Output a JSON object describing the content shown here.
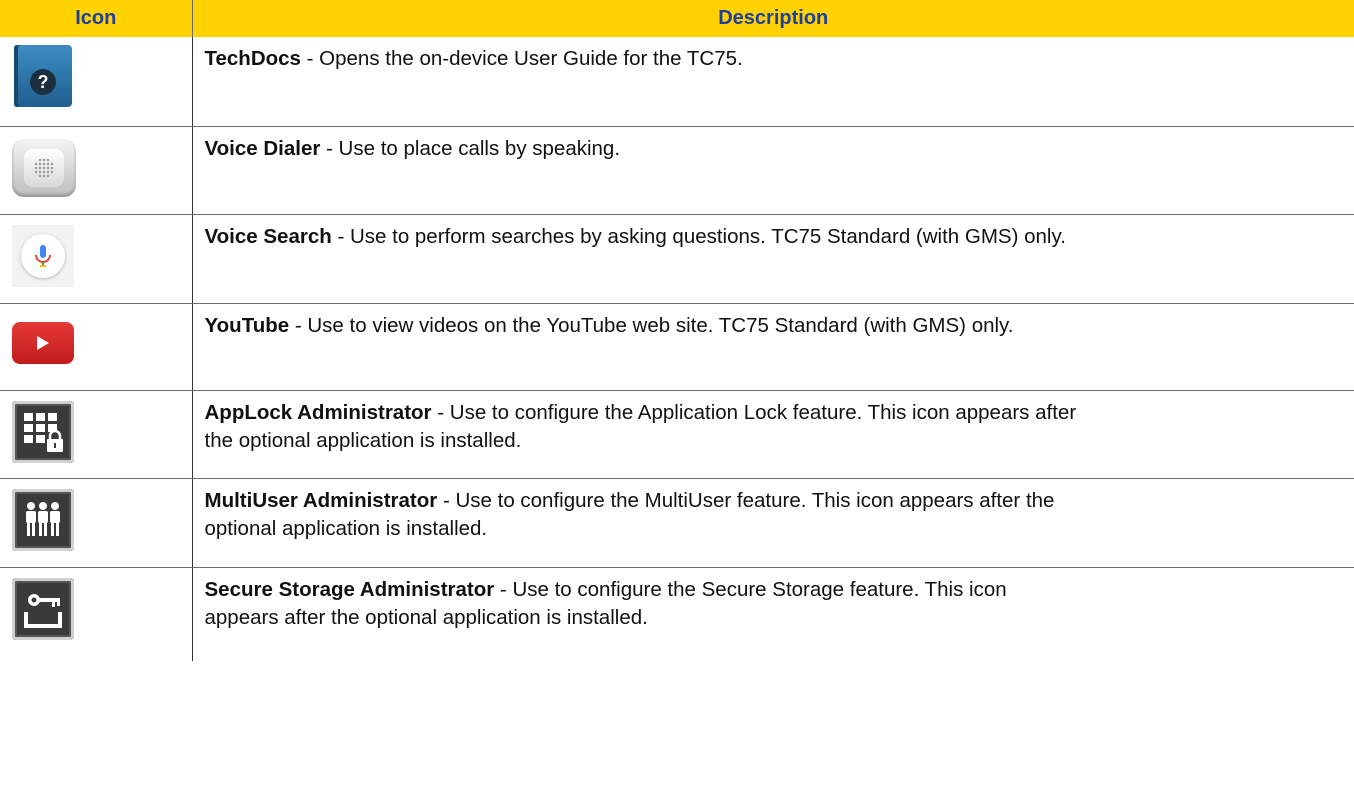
{
  "header": {
    "icon_col": "Icon",
    "description_col": "Description"
  },
  "rows": [
    {
      "icon": "techdocs-icon",
      "name": "TechDocs",
      "text": " - Opens the on-device User Guide for the TC75.",
      "line2": ""
    },
    {
      "icon": "voice-dialer-icon",
      "name": "Voice Dialer",
      "text": " - Use to place calls by speaking.",
      "line2": ""
    },
    {
      "icon": "voice-search-icon",
      "name": "Voice Search",
      "text": " - Use to perform searches by asking questions. TC75 Standard (with GMS) only.",
      "line2": ""
    },
    {
      "icon": "youtube-icon",
      "name": "YouTube",
      "text": " - Use to view videos on the YouTube web site. TC75 Standard (with GMS) only.",
      "line2": ""
    },
    {
      "icon": "applock-admin-icon",
      "name": "AppLock Administrator",
      "text": " - Use to configure the Application Lock feature. This icon appears after",
      "line2": "the optional application is installed."
    },
    {
      "icon": "multiuser-admin-icon",
      "name": "MultiUser Administrator",
      "text": " - Use to configure the MultiUser feature. This icon appears after the",
      "line2": "optional application is installed."
    },
    {
      "icon": "secure-storage-admin-icon",
      "name": "Secure Storage Administrator",
      "text": " - Use to configure the Secure Storage feature. This icon",
      "line2": "appears after the optional application is installed."
    }
  ],
  "colors": {
    "header_bg": "#FFD200",
    "header_text": "#1d3f9e"
  }
}
